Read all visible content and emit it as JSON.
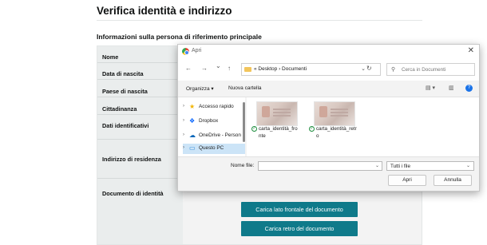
{
  "page": {
    "title": "Verifica identità e indirizzo",
    "section_title": "Informazioni sulla persona di riferimento principale",
    "rows": [
      {
        "label": "Nome"
      },
      {
        "label": "Data di nascita"
      },
      {
        "label": "Paese di nascita"
      },
      {
        "label": "Cittadinanza"
      },
      {
        "label": "Dati identificativi"
      },
      {
        "label": "Indirizzo di residenza"
      },
      {
        "label": "Documento di identità"
      }
    ],
    "upload_front": "Carica lato frontale del documento",
    "upload_back": "Carica retro del documento"
  },
  "dialog": {
    "title": "Apri",
    "close": "✕",
    "nav": {
      "back": "←",
      "forward": "→",
      "recent": "⌄",
      "up": "↑",
      "refresh": "↻"
    },
    "address": "« Desktop › Documenti",
    "address_chevron": "⌄",
    "search_placeholder": "Cerca in Documenti",
    "toolbar": {
      "organize": "Organizza ▾",
      "new_folder": "Nuova cartella"
    },
    "sidebar": [
      {
        "label": "Accesso rapido",
        "icon": "star-icon",
        "glyph": "★",
        "color": "#f2b400"
      },
      {
        "label": "Dropbox",
        "icon": "dropbox-icon",
        "glyph": "❖",
        "color": "#0061fe"
      },
      {
        "label": "OneDrive - Person",
        "icon": "cloud-icon",
        "glyph": "☁",
        "color": "#0364b8"
      },
      {
        "label": "Questo PC",
        "icon": "computer-icon",
        "glyph": "▭",
        "color": "#2b88d8",
        "selected": true
      }
    ],
    "files": [
      {
        "name": "carta_identità_fronte"
      },
      {
        "name": "carta_identità_retro"
      }
    ],
    "filename_label": "Nome file:",
    "filename_value": "",
    "filetype": "Tutti i file",
    "open_button": "Apri",
    "cancel_button": "Annulla"
  }
}
